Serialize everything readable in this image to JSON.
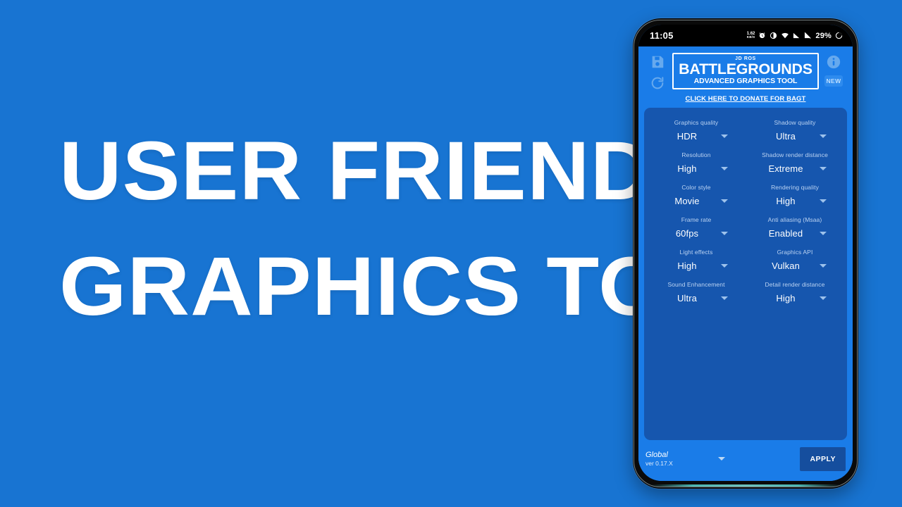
{
  "promo": {
    "line1": "USER FRIENDLY",
    "line2": "GRAPHICS TOOL",
    "background_color": "#1874D2",
    "text_color": "#FFFFFF"
  },
  "phone": {
    "status_bar": {
      "time": "11:05",
      "network_speed": "1.62",
      "network_speed_unit": "KB/S",
      "battery": "29%",
      "icons": [
        "alarm-icon",
        "do-not-disturb-icon",
        "wifi-icon",
        "signal-icon",
        "signal-mute-icon",
        "battery-icon"
      ]
    },
    "app": {
      "header": {
        "save_icon": "save-icon",
        "refresh_icon": "refresh-icon",
        "info_icon": "info-icon",
        "new_badge": "NEW",
        "logo_sub": "JD ROS",
        "logo_main": "BATTLEGROUNDS",
        "logo_tagline": "ADVANCED GRAPHICS TOOL",
        "donate_link": "CLICK HERE TO DONATE FOR BAGT"
      },
      "settings": [
        {
          "label": "Graphics quality",
          "value": "HDR"
        },
        {
          "label": "Shadow quality",
          "value": "Ultra"
        },
        {
          "label": "Resolution",
          "value": "High"
        },
        {
          "label": "Shadow render distance",
          "value": "Extreme"
        },
        {
          "label": "Color style",
          "value": "Movie"
        },
        {
          "label": "Rendering quality",
          "value": "High"
        },
        {
          "label": "Frame rate",
          "value": "60fps"
        },
        {
          "label": "Anti aliasing (Msaa)",
          "value": "Enabled"
        },
        {
          "label": "Light effects",
          "value": "High"
        },
        {
          "label": "Graphics API",
          "value": "Vulkan"
        },
        {
          "label": "Sound Enhancement",
          "value": "Ultra"
        },
        {
          "label": "Detail render distance",
          "value": "High"
        }
      ],
      "footer": {
        "profile_name": "Global",
        "version": "ver 0.17.X",
        "apply_label": "APPLY"
      },
      "colors": {
        "app_background": "#1A7CE8",
        "panel_background": "#1656AE",
        "apply_button": "#154E9E",
        "label_text": "#BBD3F2"
      }
    }
  }
}
